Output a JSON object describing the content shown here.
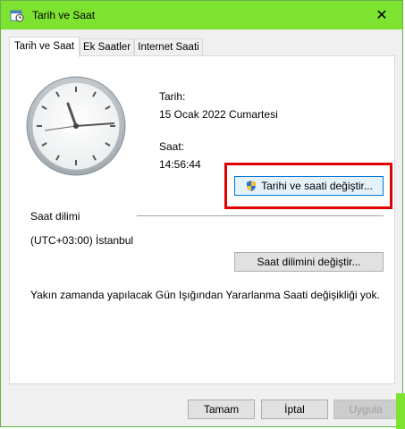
{
  "window": {
    "title": "Tarih ve Saat",
    "close_glyph": "✕"
  },
  "tabs": [
    {
      "label": "Tarih ve Saat"
    },
    {
      "label": "Ek Saatler"
    },
    {
      "label": "Internet Saati"
    }
  ],
  "date": {
    "label": "Tarih:",
    "value": "15 Ocak 2022 Cumartesi"
  },
  "time": {
    "label": "Saat:",
    "value": "14:56:44"
  },
  "change_datetime_button": "Tarihi ve saati değiştir...",
  "timezone": {
    "section_label": "Saat dilimi",
    "value": "(UTC+03:00) İstanbul",
    "change_button": "Saat dilimini değiştir..."
  },
  "dst_message": "Yakın zamanda yapılacak Gün Işığından Yararlanma Saati değişikliği yok.",
  "footer": {
    "ok": "Tamam",
    "cancel": "İptal",
    "apply": "Uygula"
  },
  "colors": {
    "titlebar": "#7de330",
    "highlight": "#e00000",
    "focus": "#0078d7"
  },
  "icons": [
    "clock-app-icon",
    "close-icon",
    "shield-icon",
    "analog-clock"
  ]
}
